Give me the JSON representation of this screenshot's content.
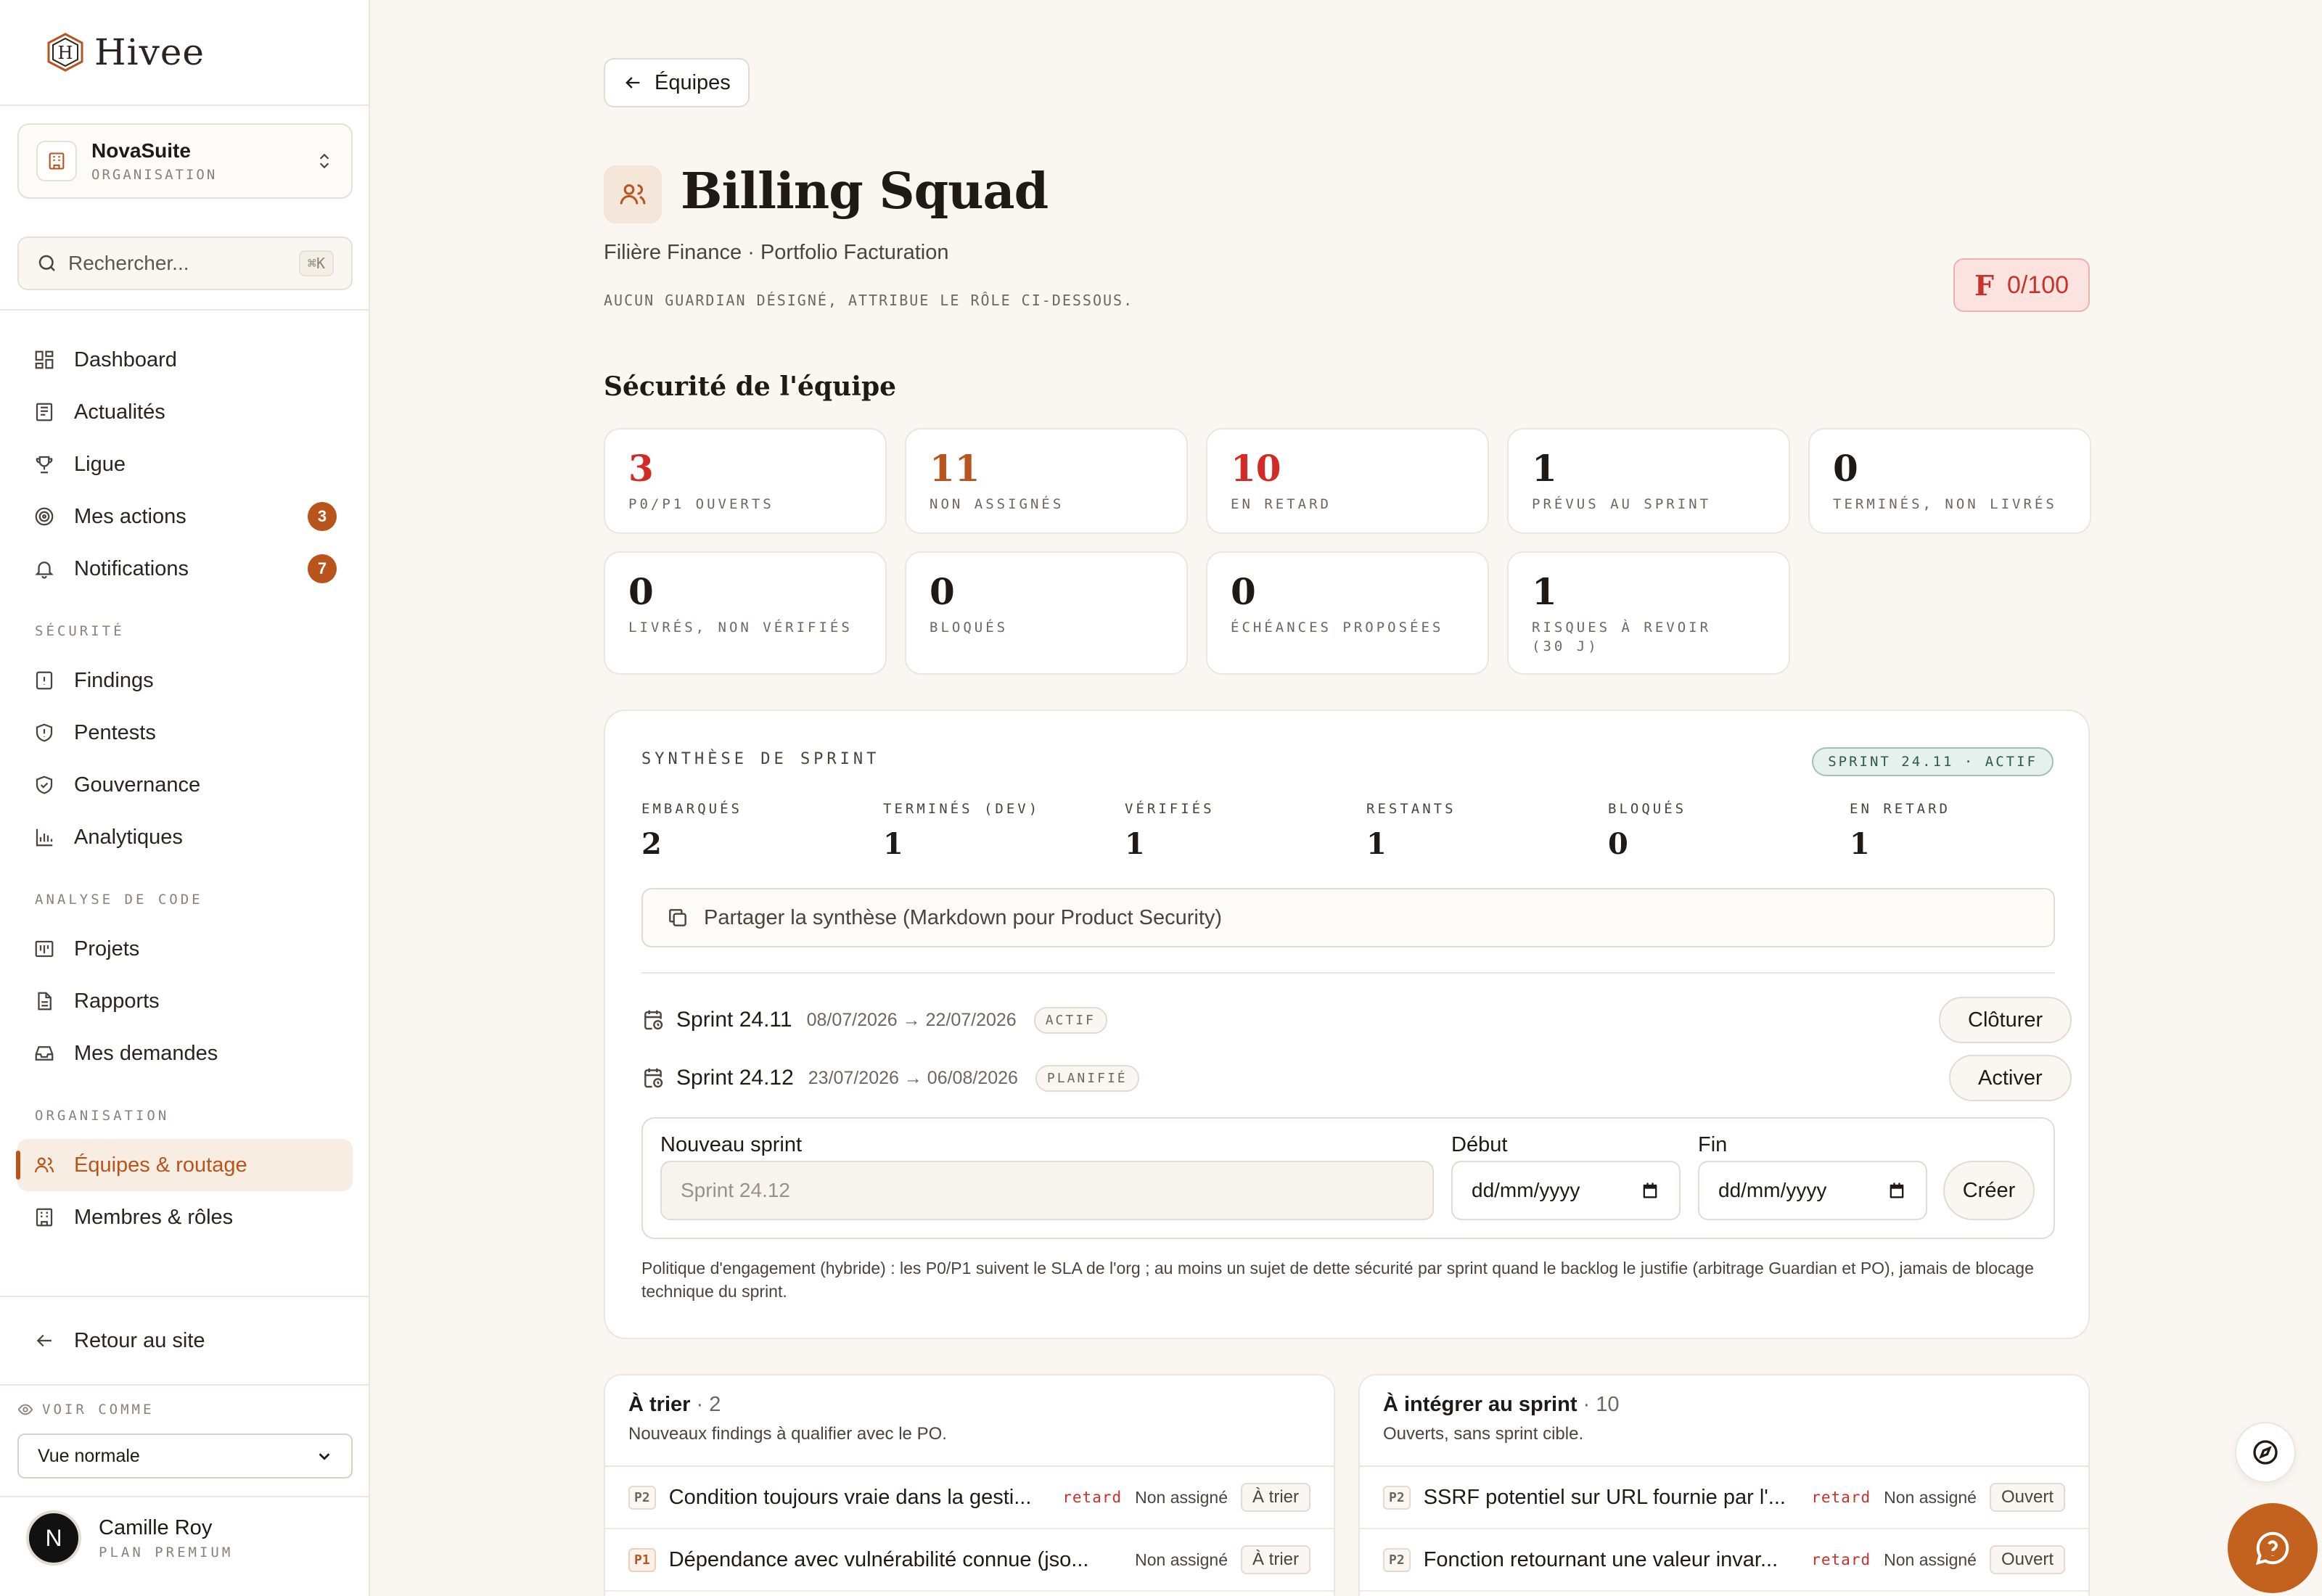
{
  "brand": {
    "name": "Hivee",
    "logo_letter": "H",
    "accent": "#b8541c"
  },
  "org": {
    "name": "NovaSuite",
    "type": "ORGANISATION"
  },
  "search": {
    "placeholder": "Rechercher...",
    "shortcut": "⌘K"
  },
  "nav": {
    "main": [
      {
        "label": "Dashboard",
        "icon": "dashboard-icon"
      },
      {
        "label": "Actualités",
        "icon": "newspaper-icon"
      },
      {
        "label": "Ligue",
        "icon": "trophy-icon"
      },
      {
        "label": "Mes actions",
        "icon": "target-icon",
        "badge": "3"
      },
      {
        "label": "Notifications",
        "icon": "bell-icon",
        "badge": "7"
      }
    ],
    "securite_title": "SÉCURITÉ",
    "securite": [
      {
        "label": "Findings",
        "icon": "alert-file-icon"
      },
      {
        "label": "Pentests",
        "icon": "shield-alert-icon"
      },
      {
        "label": "Gouvernance",
        "icon": "shield-check-icon"
      },
      {
        "label": "Analytiques",
        "icon": "bar-chart-icon"
      }
    ],
    "code_title": "ANALYSE DE CODE",
    "code": [
      {
        "label": "Projets",
        "icon": "kanban-icon"
      },
      {
        "label": "Rapports",
        "icon": "file-text-icon"
      },
      {
        "label": "Mes demandes",
        "icon": "inbox-icon"
      }
    ],
    "org_title": "ORGANISATION",
    "org": [
      {
        "label": "Équipes & routage",
        "icon": "users-icon",
        "active": true
      },
      {
        "label": "Membres & rôles",
        "icon": "building-icon"
      }
    ],
    "back": "Retour au site"
  },
  "view_as": {
    "label": "VOIR COMME",
    "value": "Vue normale"
  },
  "user": {
    "name": "Camille Roy",
    "initial": "N",
    "plan": "PLAN PREMIUM"
  },
  "header": {
    "back_label": "Équipes",
    "title": "Billing Squad",
    "subtitle": "Filière Finance · Portfolio Facturation",
    "note": "AUCUN GUARDIAN DÉSIGNÉ, ATTRIBUE LE RÔLE CI-DESSOUS.",
    "grade_letter": "F",
    "grade_score": "0/100"
  },
  "security": {
    "title": "Sécurité de l'équipe",
    "stats": [
      {
        "value": "3",
        "label": "P0/P1 OUVERTS",
        "tone": "red"
      },
      {
        "value": "11",
        "label": "NON ASSIGNÉS",
        "tone": "orange"
      },
      {
        "value": "10",
        "label": "EN RETARD",
        "tone": "red"
      },
      {
        "value": "1",
        "label": "PRÉVUS AU SPRINT",
        "tone": "dark"
      },
      {
        "value": "0",
        "label": "TERMINÉS, NON LIVRÉS",
        "tone": "dark"
      },
      {
        "value": "0",
        "label": "LIVRÉS, NON VÉRIFIÉS",
        "tone": "dark"
      },
      {
        "value": "0",
        "label": "BLOQUÉS",
        "tone": "dark"
      },
      {
        "value": "0",
        "label": "ÉCHÉANCES PROPOSÉES",
        "tone": "dark"
      },
      {
        "value": "1",
        "label": "RISQUES À REVOIR (30 J)",
        "tone": "dark"
      }
    ]
  },
  "sprint": {
    "label": "SYNTHÈSE DE SPRINT",
    "badge": "SPRINT 24.11 · ACTIF",
    "metrics": [
      {
        "label": "EMBARQUÉS",
        "value": "2"
      },
      {
        "label": "TERMINÉS (DEV)",
        "value": "1"
      },
      {
        "label": "VÉRIFIÉS",
        "value": "1"
      },
      {
        "label": "RESTANTS",
        "value": "1"
      },
      {
        "label": "BLOQUÉS",
        "value": "0"
      },
      {
        "label": "EN RETARD",
        "value": "1"
      }
    ],
    "share_label": "Partager la synthèse (Markdown pour Product Security)",
    "sprints": [
      {
        "name": "Sprint 24.11",
        "dates": "08/07/2026 → 22/07/2026",
        "status": "ACTIF",
        "action": "Clôturer"
      },
      {
        "name": "Sprint 24.12",
        "dates": "23/07/2026 → 06/08/2026",
        "status": "PLANIFIÉ",
        "action": "Activer"
      }
    ],
    "new_sprint": {
      "name_label": "Nouveau sprint",
      "name_placeholder": "Sprint 24.12",
      "start_label": "Début",
      "start_placeholder": "dd/mm/yyyy",
      "end_label": "Fin",
      "end_placeholder": "dd/mm/yyyy",
      "create_label": "Créer"
    },
    "policy": "Politique d'engagement (hybride) : les P0/P1 suivent le SLA de l'org ; au moins un sujet de dette sécurité par sprint quand le backlog le justifie (arbitrage Guardian et PO), jamais de blocage technique du sprint."
  },
  "lists": [
    {
      "title": "À trier",
      "count": " · 2",
      "subtitle": "Nouveaux findings à qualifier avec le PO.",
      "rows": [
        {
          "prio": "P2",
          "title": "Condition toujours vraie dans la gesti...",
          "late": "retard",
          "assignee": "Non assigné",
          "status": "À trier"
        },
        {
          "prio": "P1",
          "title": "Dépendance avec vulnérabilité connue (jso...",
          "late": "",
          "assignee": "Non assigné",
          "status": "À trier"
        }
      ]
    },
    {
      "title": "À intégrer au sprint",
      "count": " · 10",
      "subtitle": "Ouverts, sans sprint cible.",
      "rows": [
        {
          "prio": "P2",
          "title": "SSRF potentiel sur URL fournie par l'...",
          "late": "retard",
          "assignee": "Non assigné",
          "status": "Ouvert"
        },
        {
          "prio": "P2",
          "title": "Fonction retournant une valeur invar...",
          "late": "retard",
          "assignee": "Non assigné",
          "status": "Ouvert"
        }
      ]
    }
  ]
}
